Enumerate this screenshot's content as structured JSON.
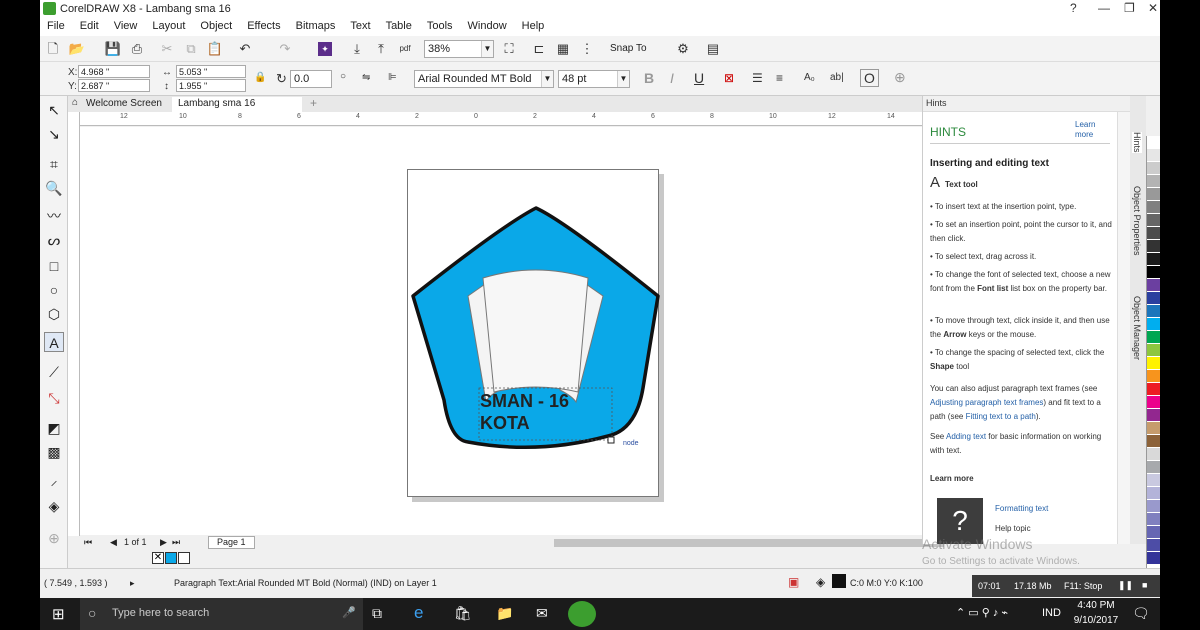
{
  "app": {
    "title": "CorelDRAW X8 - Lambang sma 16"
  },
  "menubar": [
    "File",
    "Edit",
    "View",
    "Layout",
    "Object",
    "Effects",
    "Bitmaps",
    "Text",
    "Table",
    "Tools",
    "Window",
    "Help"
  ],
  "toolbar": {
    "zoom": "38%",
    "snap_to": "Snap To"
  },
  "propbar": {
    "x": "4.968 \"",
    "y": "2.687 \"",
    "w": "5.053 \"",
    "h": "1.955 \"",
    "rotation": "0.0",
    "font": "Arial Rounded MT Bold",
    "font_size": "48 pt"
  },
  "tabs": [
    {
      "label": "Welcome Screen"
    },
    {
      "label": "Lambang sma 16"
    }
  ],
  "ruler": {
    "units": "inches",
    "ticks": [
      "12",
      "10",
      "8",
      "6",
      "4",
      "2",
      "0",
      "2",
      "4",
      "6",
      "8",
      "10",
      "12",
      "14"
    ]
  },
  "artwork": {
    "text_line1": "SMAN - 16",
    "text_line2": "KOTA",
    "node_label": "node",
    "fill_color": "#0aa8e8",
    "outline_color": "#111111"
  },
  "pagenav": {
    "page_count": "1 of 1",
    "page_tab": "Page 1"
  },
  "status": {
    "coords": "( 7.549 , 1.593 )",
    "message": "Paragraph Text:Arial Rounded MT Bold (Normal) (IND) on Layer 1",
    "fill": "C:0 M:0 Y:0 K:100",
    "time": "07:01",
    "memory": "17.18 Mb",
    "f11": "F11: Stop"
  },
  "hints": {
    "panel_title": "Hints",
    "heading": "HINTS",
    "learn_more": "Learn more",
    "topic": "Inserting and editing text",
    "tool_name": "Text tool",
    "items": [
      "To insert text at the insertion point, type.",
      "To set an insertion point, point the cursor to it, and then click.",
      "To select text, drag across it."
    ],
    "font_tip_pre": "To change the font of selected text, choose a new font from the ",
    "font_tip_bold": "Font list",
    "font_tip_post": " list box on the property bar.",
    "arrow_tip_pre": "To move through text, click inside it, and then use the ",
    "arrow_tip_bold": "Arrow",
    "arrow_tip_post": " keys or the mouse.",
    "spacing_tip_pre": "To change the spacing of selected text, click the ",
    "spacing_tip_bold": "Shape",
    "spacing_tip_post": " tool",
    "para_pre": "You can also adjust paragraph text frames (see ",
    "para_link1": "Adjusting paragraph text frames",
    "para_mid": ") and fit text to a path (see ",
    "para_link2": "Fitting text to a path",
    "para_post": ").",
    "see_pre": "See ",
    "see_link": "Adding text",
    "see_post": " for basic information on working with text.",
    "learn_more_heading": "Learn more",
    "formatting_link": "Formatting text",
    "help_topic": "Help topic"
  },
  "side_tabs": [
    "Hints",
    "Object Properties",
    "Object Manager"
  ],
  "watermark": {
    "line1": "Activate Windows",
    "line2": "Go to Settings to activate Windows."
  },
  "taskbar": {
    "search_placeholder": "Type here to search",
    "lang": "IND",
    "time": "4:40 PM",
    "date": "9/10/2017"
  },
  "palette": [
    "#ffffff",
    "#e6e6e6",
    "#cccccc",
    "#b3b3b3",
    "#999999",
    "#808080",
    "#666666",
    "#4d4d4d",
    "#333333",
    "#1a1a1a",
    "#000000",
    "#6b3fa0",
    "#2a3f9f",
    "#1b75bb",
    "#00aeef",
    "#00a651",
    "#8dc63f",
    "#fff200",
    "#f7941d",
    "#ed1c24",
    "#ec008c",
    "#92278f",
    "#c69c6d",
    "#8c6239",
    "#d9d9d9",
    "#a7a9ac",
    "#c9c9e0",
    "#b3b3d9",
    "#9999cc",
    "#8080bf",
    "#6666b3",
    "#4d4da6",
    "#333399"
  ]
}
